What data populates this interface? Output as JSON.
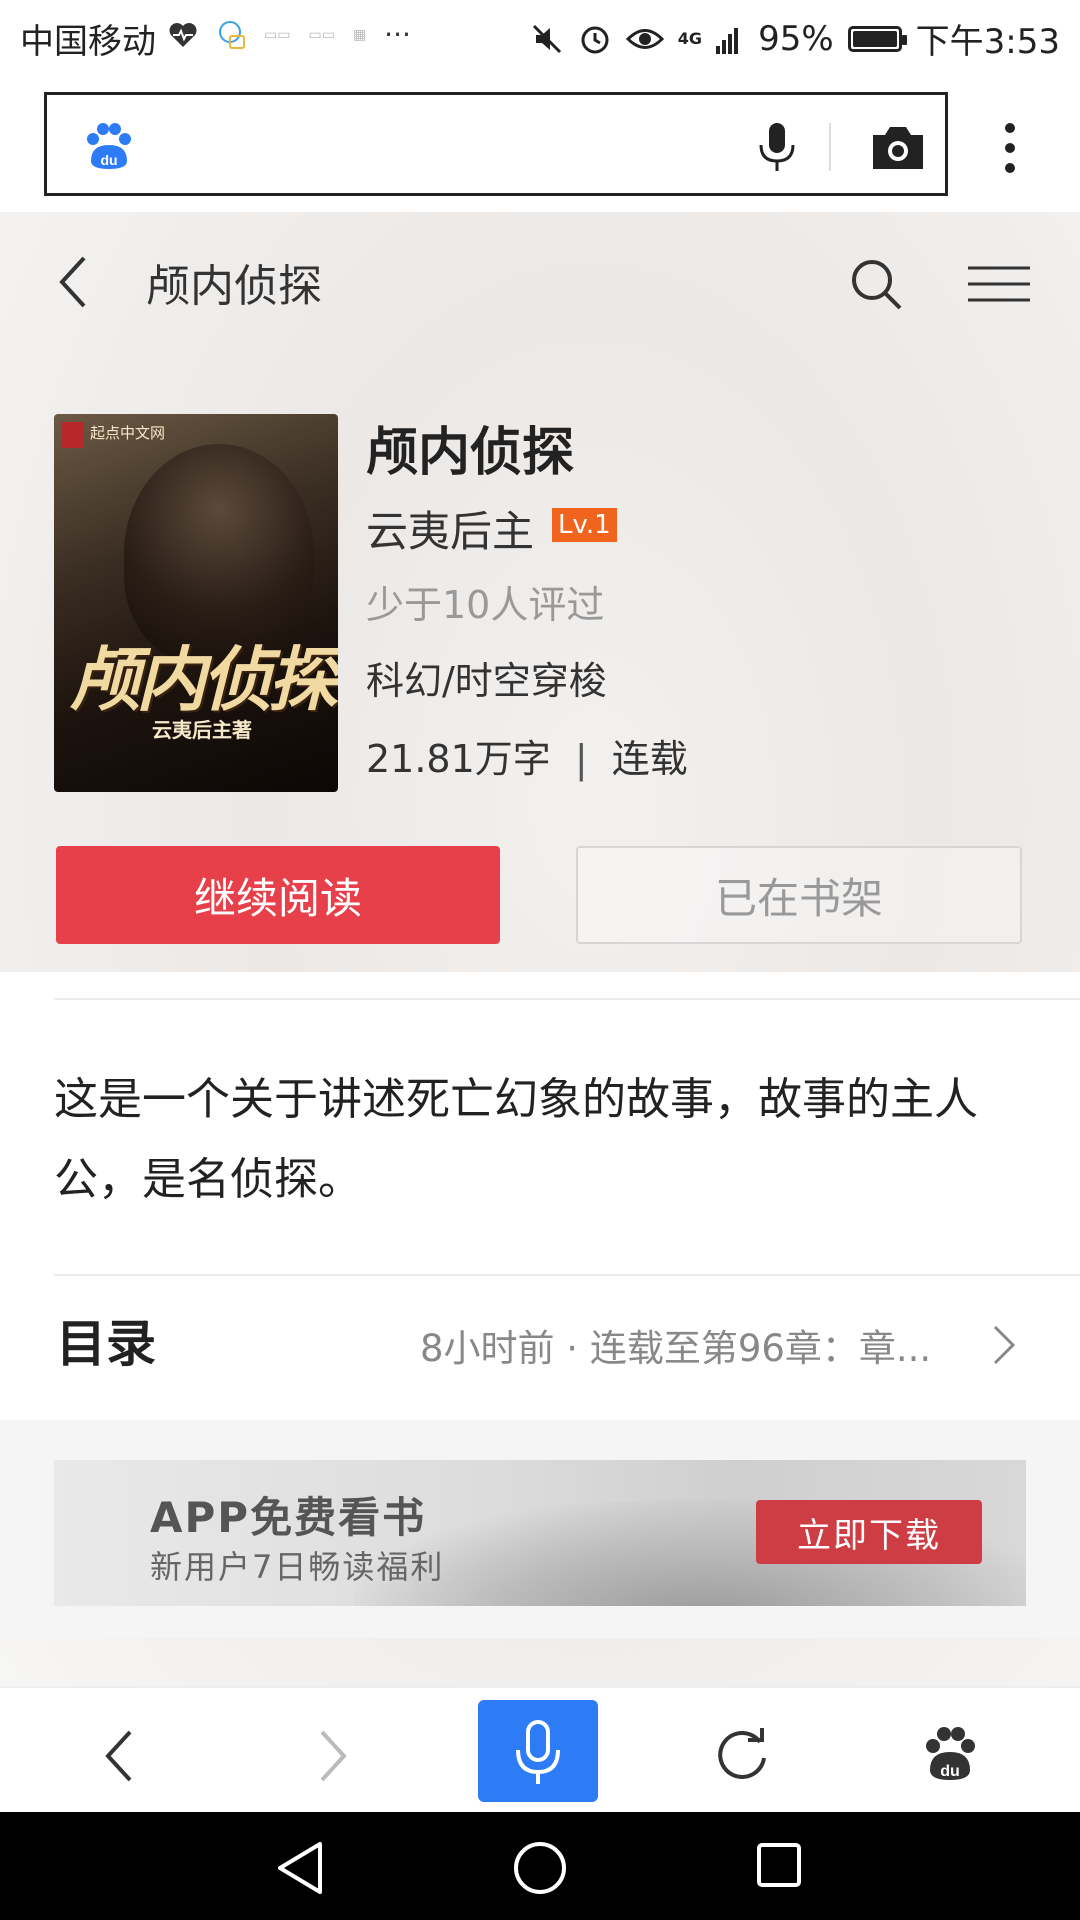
{
  "status_bar": {
    "carrier": "中国移动",
    "more": "···",
    "network": "4G",
    "battery": "95%",
    "time": "下午3:53",
    "icons": [
      "heart-monitor-icon",
      "chat-bubble-icon",
      "notification-icon",
      "notification-icon",
      "notification-icon",
      "mute-icon",
      "alarm-icon",
      "eye-icon",
      "signal-icon",
      "battery-icon"
    ]
  },
  "browser": {
    "logo_icon": "baidu-paw-icon",
    "voice_icon": "microphone-icon",
    "camera_icon": "camera-icon",
    "menu_icon": "more-vertical-icon"
  },
  "header": {
    "title": "颅内侦探"
  },
  "book": {
    "cover": {
      "publisher": "起点中文网",
      "title": "颅内侦探",
      "author": "云夷后主著"
    },
    "title": "颅内侦探",
    "author": "云夷后主",
    "level": "Lv.1",
    "reviews": "少于10人评过",
    "genre": "科幻/时空穿梭",
    "word_count": "21.81万字",
    "separator": "|",
    "status": "连载",
    "read_button": "继续阅读",
    "shelf_button": "已在书架",
    "description": "这是一个关于讲述死亡幻象的故事，故事的主人公，是名侦探。"
  },
  "toc": {
    "label": "目录",
    "update_info": "8小时前 · 连载至第96章：章..."
  },
  "ad": {
    "title": "APP免费看书",
    "subtitle": "新用户7日畅读福利",
    "button": "立即下载"
  },
  "colors": {
    "primary_red": "#e8404a",
    "level_orange": "#f0641e",
    "voice_blue": "#2d7cf6",
    "ad_button": "#cf3d44"
  }
}
